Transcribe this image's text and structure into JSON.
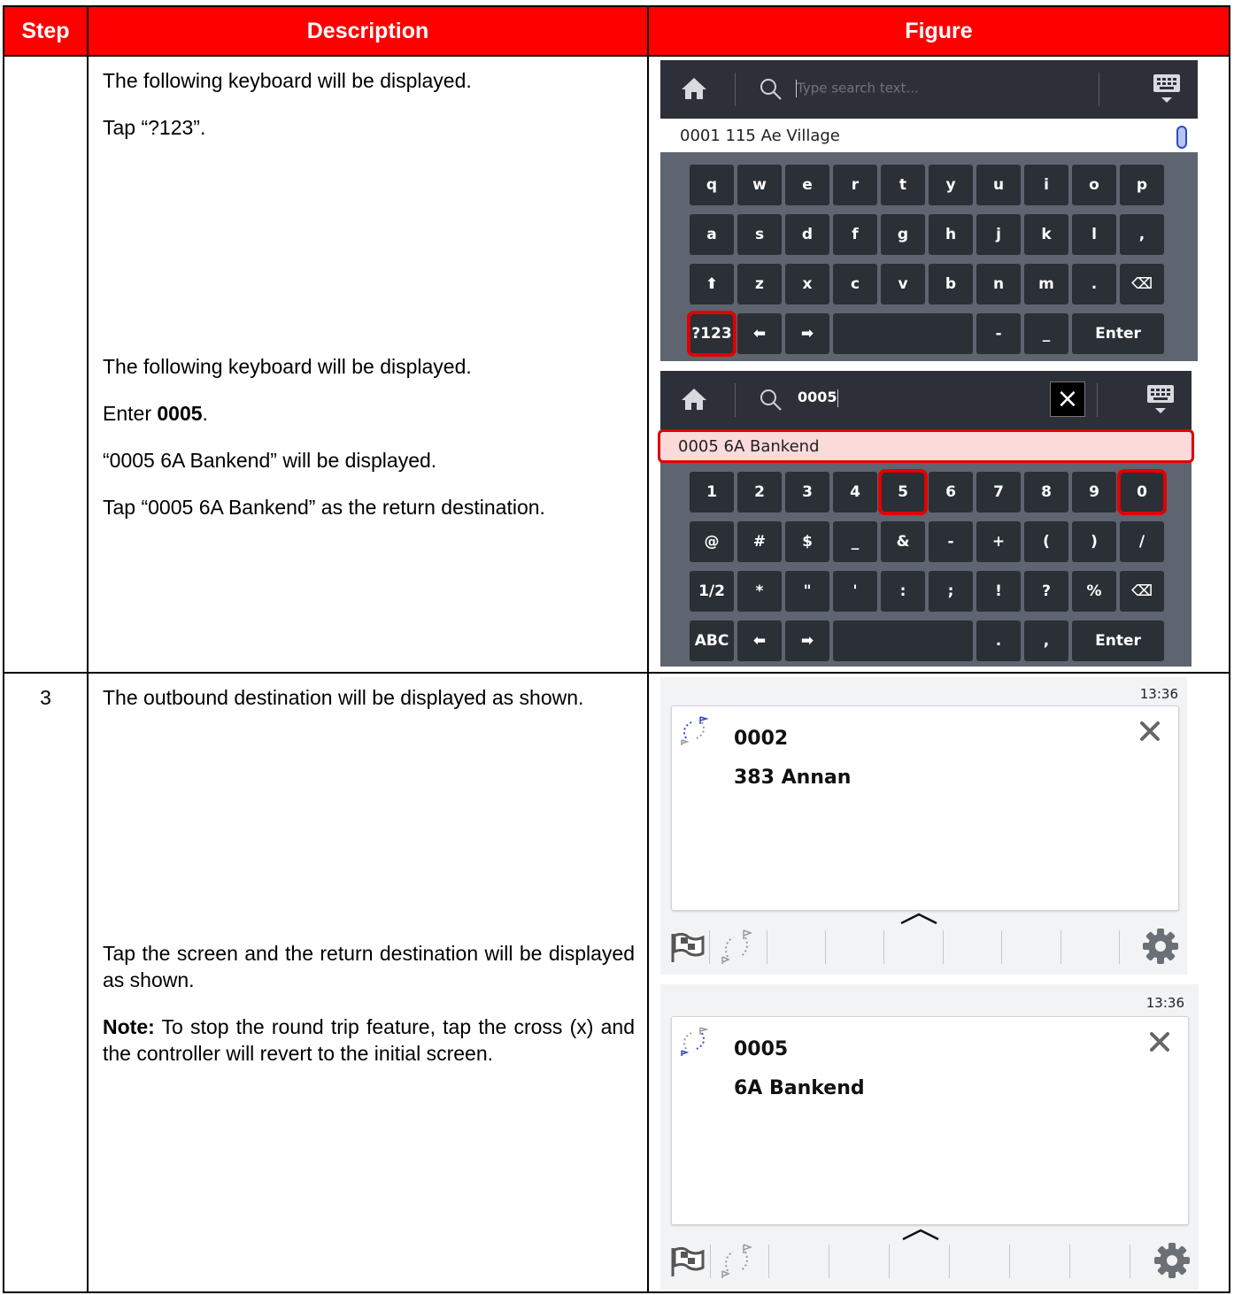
{
  "header": {
    "step": "Step",
    "description": "Description",
    "figure": "Figure"
  },
  "row1": {
    "step": "",
    "desc_a": [
      "The following keyboard will be displayed.",
      "Tap “?123”."
    ],
    "desc_b1": "The following keyboard will be displayed.",
    "desc_b2_pre": "Enter ",
    "desc_b2_bold": "0005",
    "desc_b2_post": ".",
    "desc_b3": "“0005 6A Bankend” will be displayed.",
    "desc_b4": "Tap “0005 6A Bankend” as the return destination."
  },
  "row2": {
    "step": "3",
    "desc_a": "The outbound destination will be displayed as shown.",
    "desc_b": "Tap the screen and the return destination will be displayed as shown.",
    "note_label": "Note:",
    "note_text": " To stop the round trip feature, tap the cross (x) and the controller will revert to the initial screen."
  },
  "kb1": {
    "search_placeholder": "Type search text...",
    "result": "0001 115 Ae Village",
    "row1": [
      "q",
      "w",
      "e",
      "r",
      "t",
      "y",
      "u",
      "i",
      "o",
      "p"
    ],
    "row2": [
      "a",
      "s",
      "d",
      "f",
      "g",
      "h",
      "j",
      "k",
      "l",
      ","
    ],
    "row3": [
      "⬆",
      "z",
      "x",
      "c",
      "v",
      "b",
      "n",
      "m",
      ".",
      "⌫"
    ],
    "row4": [
      "?123",
      "⬅",
      "➡",
      "",
      "-",
      "_",
      "Enter"
    ]
  },
  "kb2": {
    "search_text": "0005",
    "result": "0005 6A Bankend",
    "row1": [
      "1",
      "2",
      "3",
      "4",
      "5",
      "6",
      "7",
      "8",
      "9",
      "0"
    ],
    "row2": [
      "@",
      "#",
      "$",
      "_",
      "&",
      "-",
      "+",
      "(",
      ")",
      "/"
    ],
    "row3": [
      "1/2",
      "*",
      "\"",
      "'",
      ":",
      ";",
      "!",
      "?",
      "%",
      "⌫"
    ],
    "row4": [
      "ABC",
      "⬅",
      "➡",
      "",
      ".",
      ",",
      "Enter"
    ]
  },
  "dest1": {
    "time": "13:36",
    "code": "0002",
    "name": "383 Annan"
  },
  "dest2": {
    "time": "13:36",
    "code": "0005",
    "name": "6A Bankend"
  },
  "colors": {
    "header_red": "#ff0000",
    "highlight_red": "#e00000",
    "kb_bg": "#5e6470",
    "key_bg": "#2b2f36"
  }
}
